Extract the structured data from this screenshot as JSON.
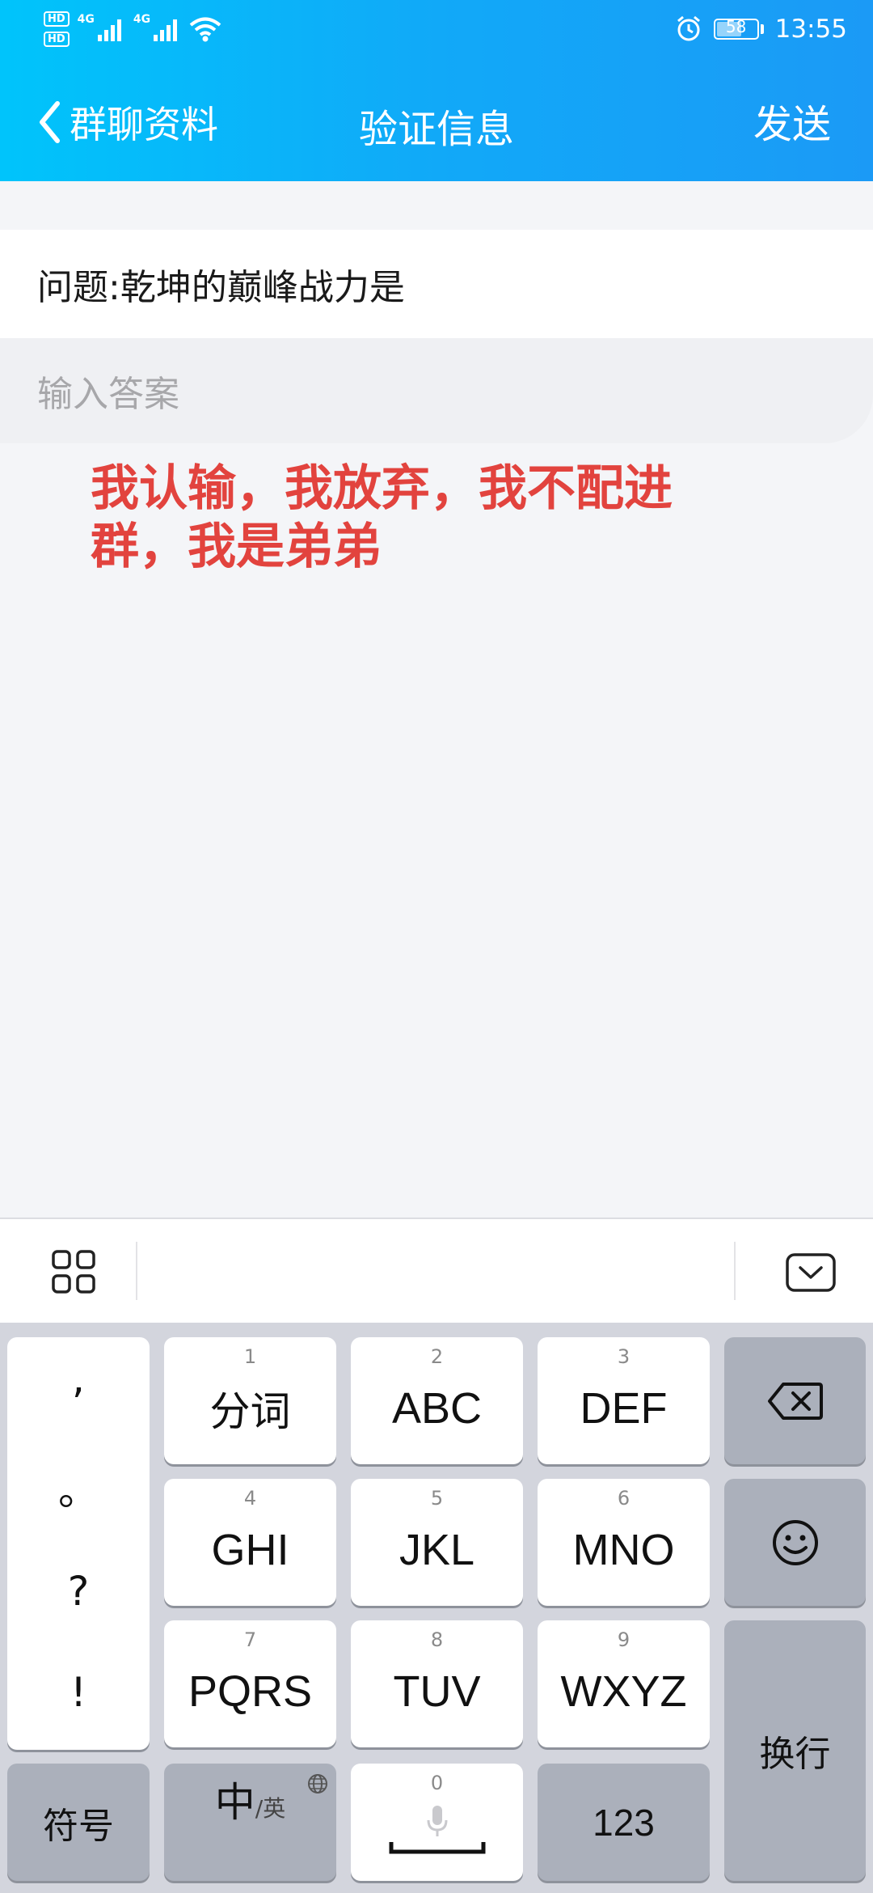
{
  "status_bar": {
    "hd1": "HD",
    "hd2": "HD",
    "net1": "4G",
    "net2": "4G",
    "battery": "58",
    "time": "13:55"
  },
  "nav": {
    "back_label": "群聊资料",
    "title": "验证信息",
    "send_label": "发送"
  },
  "question": "问题:乾坤的巅峰战力是",
  "answer_placeholder": "输入答案",
  "overlay_text": "我认输，我放弃，我不配进群，我是弟弟",
  "keyboard": {
    "punct": [
      ",",
      "。",
      "?",
      "!"
    ],
    "keys": [
      {
        "num": "1",
        "label": "分词"
      },
      {
        "num": "2",
        "label": "ABC"
      },
      {
        "num": "3",
        "label": "DEF"
      },
      {
        "num": "4",
        "label": "GHI"
      },
      {
        "num": "5",
        "label": "JKL"
      },
      {
        "num": "6",
        "label": "MNO"
      },
      {
        "num": "7",
        "label": "PQRS"
      },
      {
        "num": "8",
        "label": "TUV"
      },
      {
        "num": "9",
        "label": "WXYZ"
      }
    ],
    "symbols": "符号",
    "lang_main": "中",
    "lang_alt": "/英",
    "space_num": "0",
    "num_key": "123",
    "enter": "换行"
  },
  "colors": {
    "header_start": "#00c4fb",
    "header_end": "#1b9af6",
    "overlay_red": "#e2433e",
    "background": "#f4f5f8"
  }
}
